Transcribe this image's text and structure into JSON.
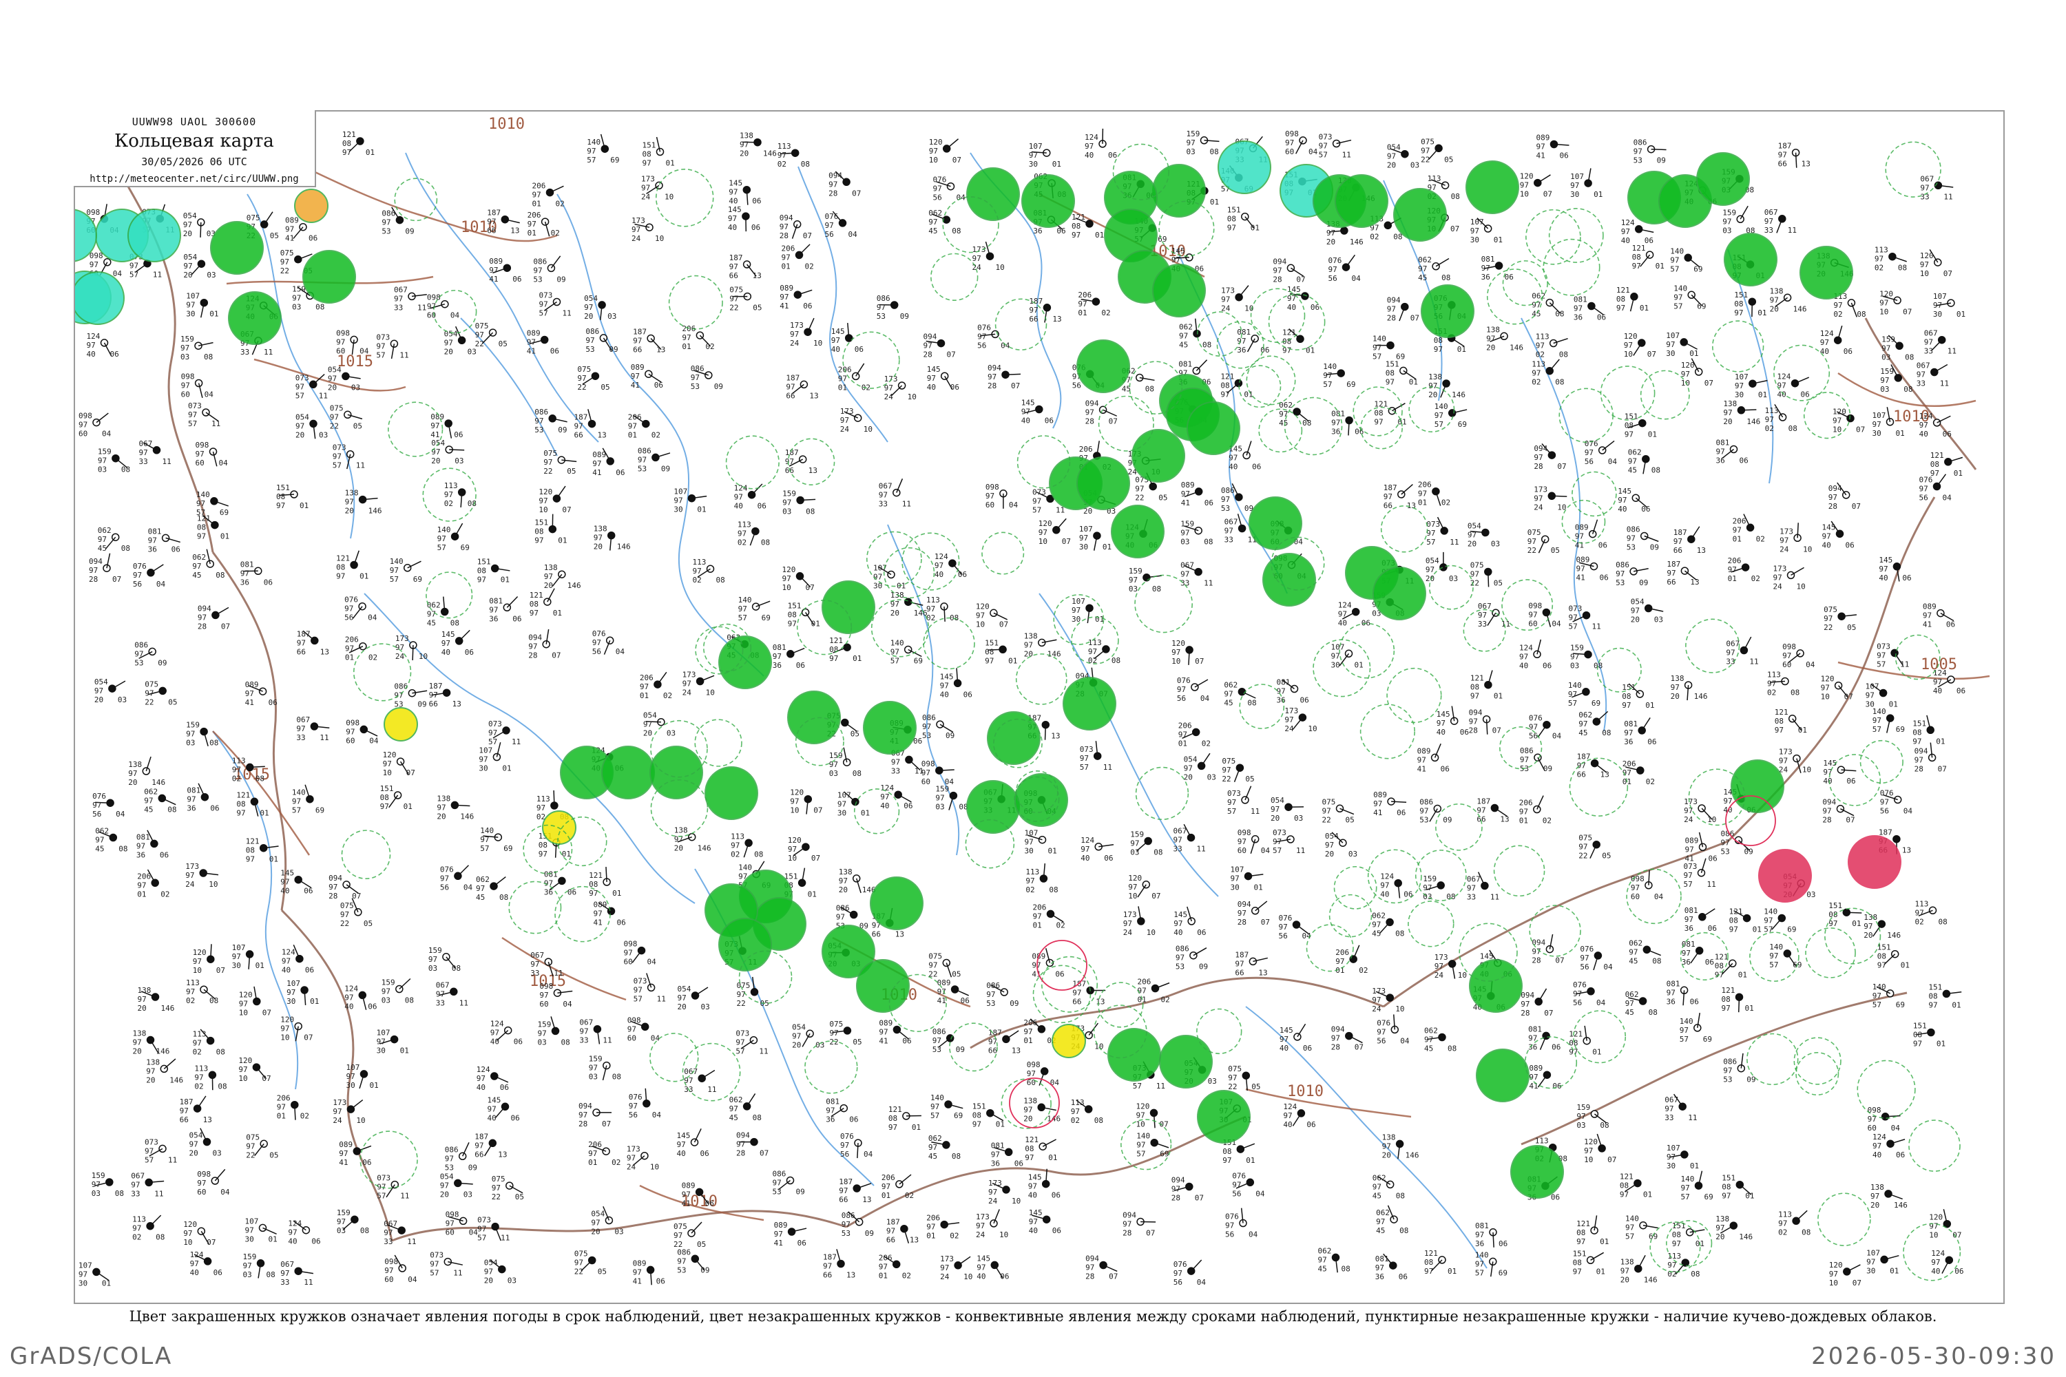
{
  "header": {
    "code": "UUWW98  UAOL  300600",
    "title": "Кольцевая карта",
    "datetime": "30/05/2026 06 UTC",
    "url": "http://meteocenter.net/circ/UUWW.png"
  },
  "legend_note": "Цвет закрашенных кружков означает явления погоды в срок наблюдений, цвет незакрашенных кружков - конвективные явления между сроками наблюдений, пунктирные незакрашенные кружки - наличие кучево-дождевых облаков.",
  "footer": {
    "left": "GrADS/COLA",
    "right": "2026-05-30-09:30"
  },
  "colors": {
    "rain": "#11bb22",
    "shower_ring": "#33aa44",
    "fog": "#33e0c0",
    "haze": "#f2e600",
    "dust": "#f0a830",
    "thunder": "#e0305a",
    "isobar": "#a05a40",
    "river": "#5aa0e0",
    "border": "#8a5a48"
  },
  "isobar_labels": [
    "1010",
    "1010",
    "1015",
    "1010",
    "1010",
    "1005",
    "1015",
    "1015",
    "1010",
    "1010",
    "1010"
  ],
  "station_models": [
    {
      "pressure": "121",
      "temp": "08",
      "dew": "97",
      "extra": "01"
    },
    {
      "pressure": "140",
      "temp": "97",
      "dew": "57",
      "extra": "69"
    },
    {
      "pressure": "151",
      "temp": "08",
      "dew": "97",
      "extra": "01"
    },
    {
      "pressure": "138",
      "temp": "97",
      "dew": "20",
      "extra": "146"
    },
    {
      "pressure": "113",
      "temp": "97",
      "dew": "02",
      "extra": "08"
    },
    {
      "pressure": "120",
      "temp": "97",
      "dew": "10",
      "extra": "07"
    },
    {
      "pressure": "107",
      "temp": "97",
      "dew": "30",
      "extra": "01"
    },
    {
      "pressure": "124",
      "temp": "97",
      "dew": "40",
      "extra": "06"
    },
    {
      "pressure": "159",
      "temp": "97",
      "dew": "03",
      "extra": "08"
    },
    {
      "pressure": "067",
      "temp": "97",
      "dew": "33",
      "extra": "11"
    },
    {
      "pressure": "098",
      "temp": "97",
      "dew": "60",
      "extra": "04"
    },
    {
      "pressure": "073",
      "temp": "97",
      "dew": "57",
      "extra": "11"
    },
    {
      "pressure": "054",
      "temp": "97",
      "dew": "20",
      "extra": "03"
    },
    {
      "pressure": "075",
      "temp": "97",
      "dew": "22",
      "extra": "05"
    },
    {
      "pressure": "089",
      "temp": "97",
      "dew": "41",
      "extra": "06"
    },
    {
      "pressure": "086",
      "temp": "97",
      "dew": "53",
      "extra": "09"
    },
    {
      "pressure": "187",
      "temp": "97",
      "dew": "66",
      "extra": "13"
    },
    {
      "pressure": "206",
      "temp": "97",
      "dew": "01",
      "extra": "02"
    },
    {
      "pressure": "173",
      "temp": "97",
      "dew": "24",
      "extra": "10"
    },
    {
      "pressure": "145",
      "temp": "97",
      "dew": "40",
      "extra": "06"
    },
    {
      "pressure": "094",
      "temp": "97",
      "dew": "28",
      "extra": "07"
    },
    {
      "pressure": "076",
      "temp": "97",
      "dew": "56",
      "extra": "04"
    },
    {
      "pressure": "062",
      "temp": "97",
      "dew": "45",
      "extra": "08"
    },
    {
      "pressure": "081",
      "temp": "97",
      "dew": "36",
      "extra": "06"
    }
  ]
}
